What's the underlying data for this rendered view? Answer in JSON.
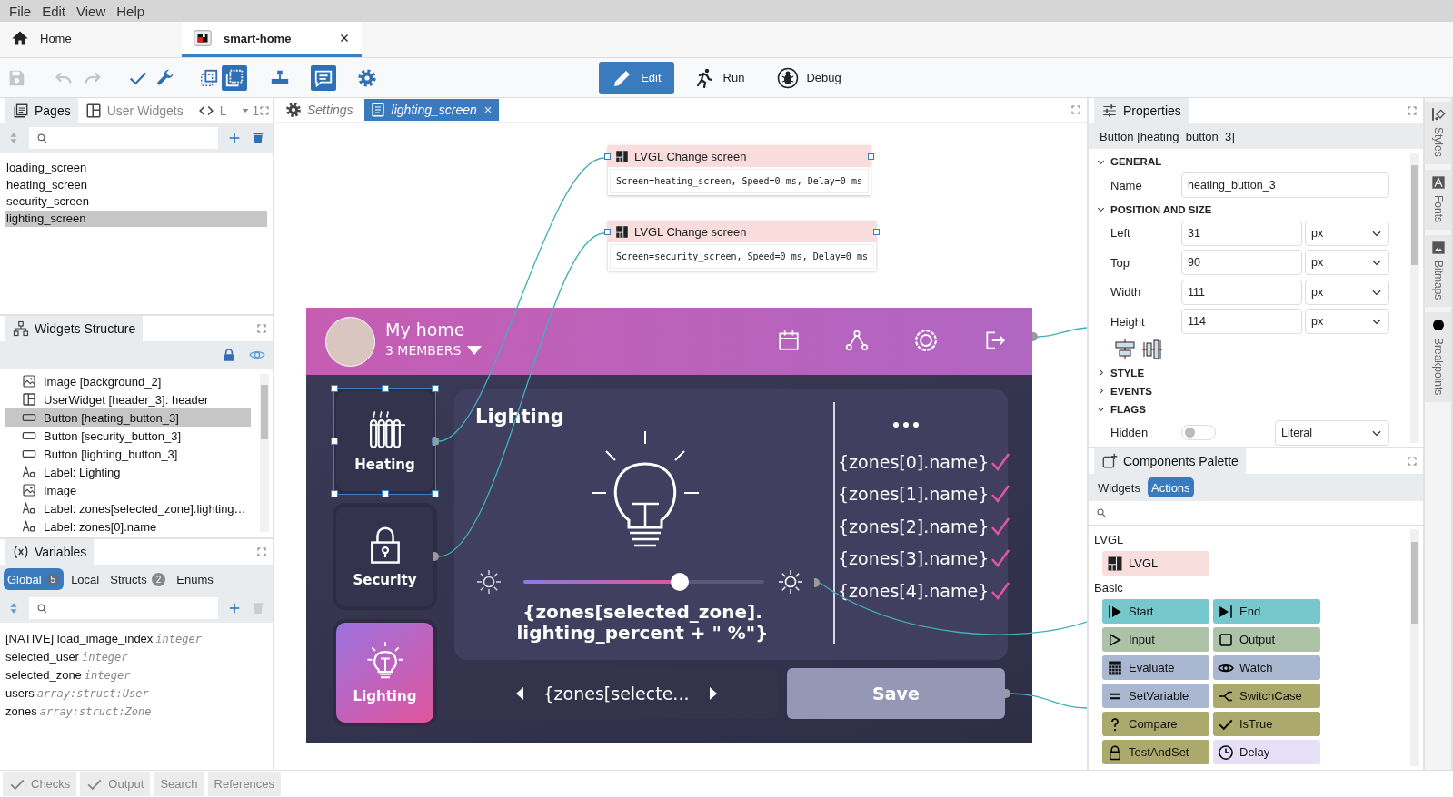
{
  "menu": [
    "File",
    "Edit",
    "View",
    "Help"
  ],
  "doc_tabs": [
    {
      "kind": "home",
      "label": "Home",
      "selected": false,
      "closable": false
    },
    {
      "kind": "project",
      "label": "smart-home",
      "selected": true,
      "closable": true
    }
  ],
  "tools": [
    {
      "kind": "save",
      "disabled": true,
      "on": false
    },
    {
      "kind": "undo",
      "disabled": true,
      "on": false
    },
    {
      "kind": "redo",
      "disabled": true,
      "on": false
    },
    {
      "kind": "check",
      "disabled": false,
      "on": false
    },
    {
      "kind": "wrench",
      "disabled": false,
      "on": false
    },
    {
      "kind": "select-frame",
      "disabled": false,
      "on": false
    },
    {
      "kind": "select-all",
      "disabled": false,
      "on": true
    },
    {
      "kind": "hierarchy",
      "disabled": false,
      "on": false
    },
    {
      "kind": "comment",
      "disabled": false,
      "on": true
    },
    {
      "kind": "settings",
      "disabled": false,
      "on": false
    }
  ],
  "modes": [
    {
      "kind": "edit",
      "label": "Edit",
      "selected": true
    },
    {
      "kind": "run",
      "label": "Run",
      "selected": false
    },
    {
      "kind": "debug",
      "label": "Debug",
      "selected": false
    }
  ],
  "pages_panel": {
    "tabs": [
      {
        "kind": "pages",
        "label": "Pages",
        "selected": true
      },
      {
        "kind": "widgets",
        "label": "User Widgets",
        "selected": false
      },
      {
        "kind": "code",
        "label": "L",
        "selected": false
      }
    ],
    "overflow": "1",
    "items": [
      {
        "label": "loading_screen",
        "selected": false
      },
      {
        "label": "heating_screen",
        "selected": false
      },
      {
        "label": "security_screen",
        "selected": false
      },
      {
        "label": "lighting_screen",
        "selected": true
      }
    ]
  },
  "widgets_panel": {
    "title": "Widgets Structure",
    "items": [
      {
        "kind": "image",
        "label": "Image [background_2]",
        "selected": false
      },
      {
        "kind": "userwidget",
        "label": "UserWidget [header_3]: header",
        "selected": false
      },
      {
        "kind": "button",
        "label": "Button [heating_button_3]",
        "selected": true
      },
      {
        "kind": "button",
        "label": "Button [security_button_3]",
        "selected": false
      },
      {
        "kind": "button",
        "label": "Button [lighting_button_3]",
        "selected": false
      },
      {
        "kind": "label",
        "label": "Label: Lighting",
        "selected": false
      },
      {
        "kind": "image",
        "label": "Image",
        "selected": false
      },
      {
        "kind": "label",
        "label": "Label: zones[selected_zone].lighting…",
        "selected": false
      },
      {
        "kind": "label",
        "label": "Label: zones[0].name",
        "selected": false
      }
    ]
  },
  "variables_panel": {
    "title": "Variables",
    "tabs": [
      {
        "label": "Global",
        "count": "5",
        "selected": true
      },
      {
        "label": "Local",
        "selected": false
      },
      {
        "label": "Structs",
        "count": "2",
        "selected": false
      },
      {
        "label": "Enums",
        "selected": false
      }
    ],
    "items": [
      {
        "name": "[NATIVE] load_image_index",
        "type": "integer"
      },
      {
        "name": "selected_user",
        "type": "integer"
      },
      {
        "name": "selected_zone",
        "type": "integer"
      },
      {
        "name": "users",
        "type": "array:struct:User"
      },
      {
        "name": "zones",
        "type": "array:struct:Zone"
      }
    ]
  },
  "editor_tabs": [
    {
      "kind": "settings",
      "label": "Settings",
      "selected": false,
      "closable": false
    },
    {
      "kind": "page",
      "label": "lighting_screen",
      "selected": true,
      "closable": true
    }
  ],
  "canvas": {
    "actions": [
      {
        "title": "LVGL Change screen",
        "params": "Screen=heating_screen, Speed=0 ms, Delay=0 ms"
      },
      {
        "title": "LVGL Change screen",
        "params": "Screen=security_screen, Speed=0 ms, Delay=0 ms"
      }
    ],
    "screen": {
      "title": "My home",
      "members": "3 MEMBERS",
      "nav": [
        {
          "kind": "radiator",
          "label": "Heating",
          "selected": true,
          "active": false
        },
        {
          "kind": "lock",
          "label": "Security",
          "selected": false,
          "active": false
        },
        {
          "kind": "bulb",
          "label": "Lighting",
          "selected": false,
          "active": true
        }
      ],
      "panel_title": "Lighting",
      "zones": [
        {
          "label": "{zones[0].name}",
          "checked": true
        },
        {
          "label": "{zones[1].name}",
          "checked": true
        },
        {
          "label": "{zones[2].name}",
          "checked": true
        },
        {
          "label": "{zones[3].name}",
          "checked": true
        },
        {
          "label": "{zones[4].name}",
          "checked": true
        }
      ],
      "brightness": {
        "level": 0.65
      },
      "percent": "{zones[selected_zone]. lighting_percent + \" %\"}",
      "selector": "{zones[selecte...",
      "save": "Save"
    }
  },
  "properties": {
    "title": "Properties",
    "subtitle": "Button [heating_button_3]",
    "sections": [
      {
        "title": "GENERAL",
        "expanded": true,
        "fields": [
          {
            "label": "Name",
            "value": "heating_button_3"
          }
        ]
      },
      {
        "title": "POSITION AND SIZE",
        "expanded": true,
        "fields": [
          {
            "label": "Left",
            "value": "31",
            "unit": "px"
          },
          {
            "label": "Top",
            "value": "90",
            "unit": "px"
          },
          {
            "label": "Width",
            "value": "111",
            "unit": "px"
          },
          {
            "label": "Height",
            "value": "114",
            "unit": "px"
          }
        ]
      },
      {
        "title": "STYLE",
        "expanded": false
      },
      {
        "title": "EVENTS",
        "expanded": false
      },
      {
        "title": "FLAGS",
        "expanded": true,
        "fields": [
          {
            "label": "Hidden",
            "on": false,
            "mode": "Literal"
          }
        ]
      }
    ]
  },
  "palette": {
    "title": "Components Palette",
    "tabs": [
      {
        "label": "Widgets",
        "selected": false
      },
      {
        "label": "Actions",
        "selected": true
      }
    ],
    "groups": [
      {
        "title": "LVGL",
        "items": [
          {
            "kind": "lvgl",
            "label": "LVGL",
            "color": "#f9dede"
          }
        ]
      },
      {
        "title": "Basic",
        "items": [
          {
            "kind": "start",
            "label": "Start",
            "color": "#76c8cc"
          },
          {
            "kind": "end",
            "label": "End",
            "color": "#76c8cc"
          },
          {
            "kind": "input",
            "label": "Input",
            "color": "#adc3a8"
          },
          {
            "kind": "output",
            "label": "Output",
            "color": "#adc3a8"
          },
          {
            "kind": "evaluate",
            "label": "Evaluate",
            "color": "#a9b8d0"
          },
          {
            "kind": "watch",
            "label": "Watch",
            "color": "#a9b8d0"
          },
          {
            "kind": "setvar",
            "label": "SetVariable",
            "color": "#a9b8d0"
          },
          {
            "kind": "switch",
            "label": "SwitchCase",
            "color": "#aba96c"
          },
          {
            "kind": "compare",
            "label": "Compare",
            "color": "#aba96c"
          },
          {
            "kind": "istrue",
            "label": "IsTrue",
            "color": "#aba96c"
          },
          {
            "kind": "testandset",
            "label": "TestAndSet",
            "color": "#aba96c"
          },
          {
            "kind": "delay",
            "label": "Delay",
            "color": "#e5e0f7"
          }
        ]
      }
    ]
  },
  "side_tabs": [
    {
      "kind": "styles",
      "label": "Styles"
    },
    {
      "kind": "fonts",
      "label": "Fonts"
    },
    {
      "kind": "bitmaps",
      "label": "Bitmaps"
    },
    {
      "kind": "breakpoints",
      "label": "Breakpoints"
    }
  ],
  "status_tabs": [
    {
      "kind": "check",
      "label": "Checks"
    },
    {
      "kind": "check",
      "label": "Output"
    },
    {
      "kind": "plain",
      "label": "Search"
    },
    {
      "kind": "plain",
      "label": "References"
    }
  ]
}
